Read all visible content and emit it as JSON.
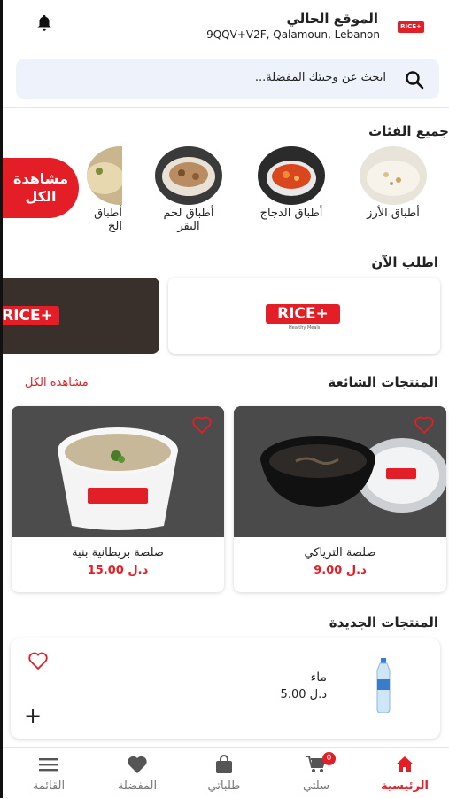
{
  "header": {
    "logo_text": "RICE+",
    "location_title": "الموقع الحالي",
    "location_address": "9QQV+V2F, Qalamoun, Lebanon"
  },
  "search": {
    "placeholder": "ابحث عن وجبتك المفضلة..."
  },
  "categories": {
    "title": "جميع الفئات",
    "items": [
      {
        "label": "أطباق الأرز"
      },
      {
        "label": "أطباق الدجاج"
      },
      {
        "label": "أطباق لحم البقر"
      },
      {
        "label": "أطباق الخ"
      }
    ],
    "see_all": "مشاهدة الكل"
  },
  "order_now": {
    "title": "اطلب الآن",
    "banner_text": "RICE+",
    "banner_sub": "Healthy Meals"
  },
  "popular": {
    "title": "المنتجات الشائعة",
    "see_all": "مشاهدة الكل",
    "products": [
      {
        "name": "صلصة الترياكي",
        "price": "9.00 د.ل"
      },
      {
        "name": "صلصة بريطانية بنية",
        "price": "15.00 د.ل"
      }
    ]
  },
  "new_products": {
    "title": "المنتجات الجديدة",
    "items": [
      {
        "name": "ماء",
        "price": "5.00 د.ل"
      }
    ]
  },
  "bottom_nav": {
    "items": [
      {
        "label": "الرئيسية",
        "icon": "home-icon",
        "active": true
      },
      {
        "label": "سلتي",
        "icon": "cart-icon",
        "badge": "0"
      },
      {
        "label": "طلباتي",
        "icon": "bag-icon"
      },
      {
        "label": "المفضلة",
        "icon": "heart-icon"
      },
      {
        "label": "القائمة",
        "icon": "menu-icon"
      }
    ]
  },
  "colors": {
    "accent": "#e31e26",
    "search_bg": "#eef3fb"
  }
}
